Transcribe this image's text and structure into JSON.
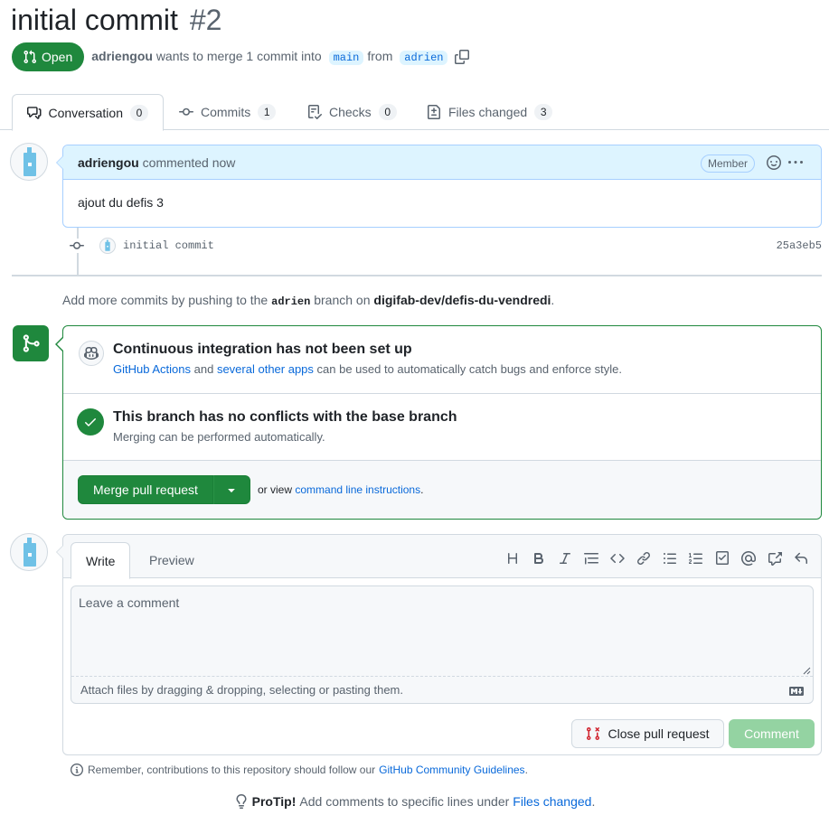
{
  "pr": {
    "title": "initial commit",
    "number": "#2",
    "state": "Open",
    "author": "adriengou",
    "merge_text": "wants to merge 1 commit into",
    "base_branch": "main",
    "from_text": "from",
    "head_branch": "adrien"
  },
  "tabs": [
    {
      "label": "Conversation",
      "count": "0"
    },
    {
      "label": "Commits",
      "count": "1"
    },
    {
      "label": "Checks",
      "count": "0"
    },
    {
      "label": "Files changed",
      "count": "3"
    }
  ],
  "comment": {
    "author": "adriengou",
    "meta": "commented now",
    "role": "Member",
    "body": "ajout du defis 3"
  },
  "commit": {
    "message": "initial commit",
    "sha": "25a3eb5"
  },
  "push_note": {
    "prefix": "Add more commits by pushing to the",
    "branch": "adrien",
    "middle": "branch on",
    "repo": "digifab-dev/defis-du-vendredi",
    "suffix": "."
  },
  "merge_box": {
    "ci_title": "Continuous integration has not been set up",
    "ci_link1": "GitHub Actions",
    "ci_and": "and",
    "ci_link2": "several other apps",
    "ci_rest": "can be used to automatically catch bugs and enforce style.",
    "conflict_title": "This branch has no conflicts with the base branch",
    "conflict_sub": "Merging can be performed automatically.",
    "merge_button": "Merge pull request",
    "or_view": "or view",
    "cli_link": "command line instructions",
    "cli_suffix": "."
  },
  "new_comment": {
    "write_tab": "Write",
    "preview_tab": "Preview",
    "placeholder": "Leave a comment",
    "attach_text": "Attach files by dragging & dropping, selecting or pasting them.",
    "close_button": "Close pull request",
    "comment_button": "Comment"
  },
  "footer": {
    "remember_prefix": "Remember, contributions to this repository should follow our",
    "guidelines_link": "GitHub Community Guidelines",
    "remember_suffix": ".",
    "protip_label": "ProTip!",
    "protip_text": "Add comments to specific lines under",
    "protip_link": "Files changed",
    "protip_suffix": "."
  },
  "colors": {
    "success": "#1f883d",
    "link": "#0969da",
    "comment_header": "#ddf4ff",
    "muted": "#59636e"
  }
}
